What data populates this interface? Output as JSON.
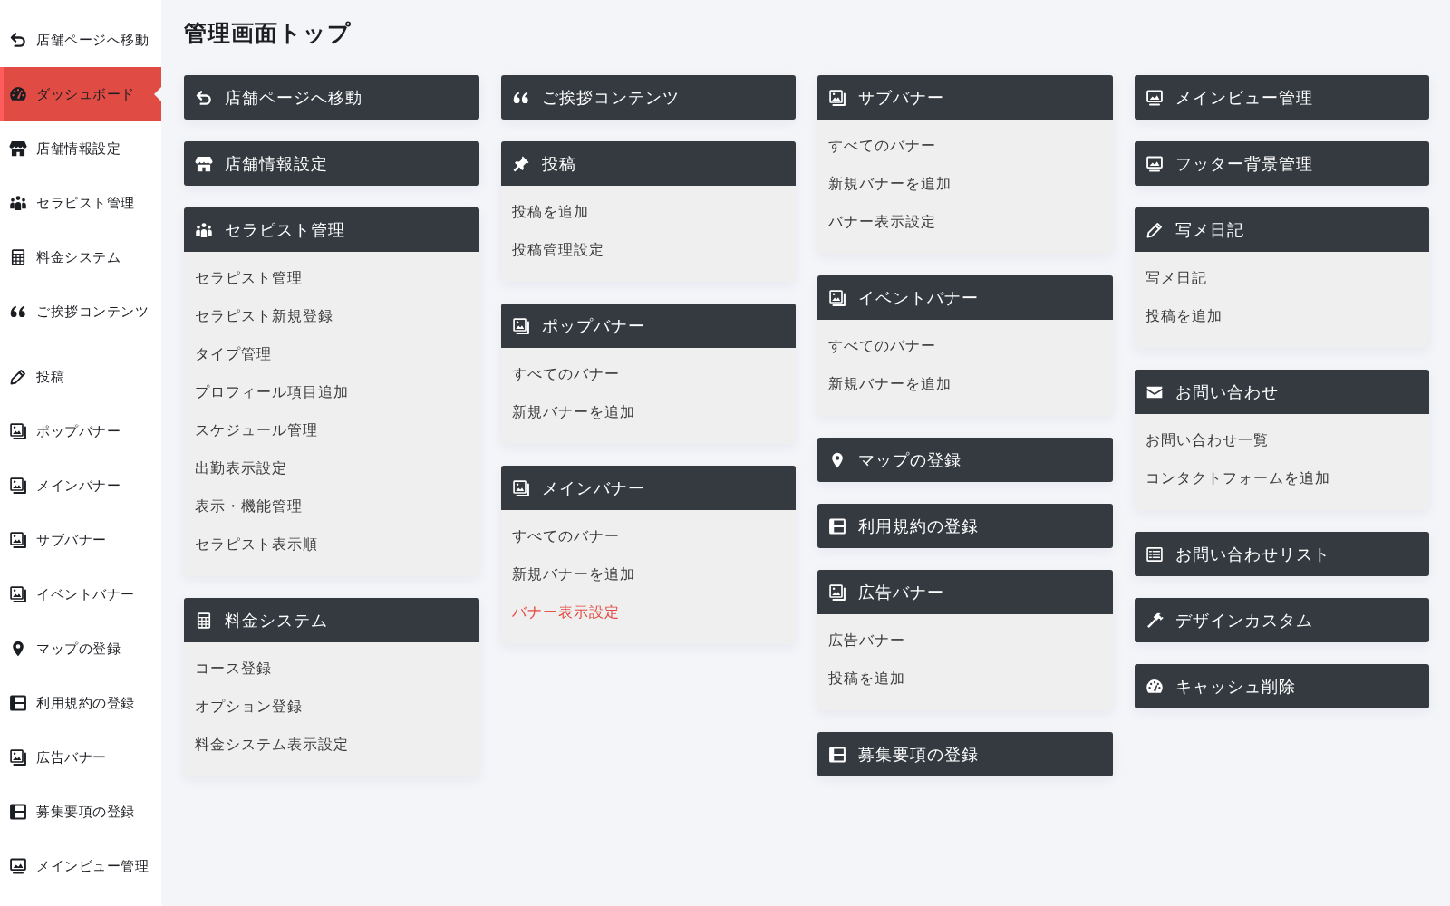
{
  "sidebar": {
    "items": [
      {
        "label": "店舗ページへ移動",
        "selected": false
      },
      {
        "label": "ダッシュボード",
        "selected": true
      },
      {
        "label": "店舗情報設定",
        "selected": false
      },
      {
        "label": "セラピスト管理",
        "selected": false
      },
      {
        "label": "料金システム",
        "selected": false
      },
      {
        "label": "ご挨拶コンテンツ",
        "selected": false
      },
      {
        "label": "投稿",
        "selected": false
      },
      {
        "label": "ポップバナー",
        "selected": false
      },
      {
        "label": "メインバナー",
        "selected": false
      },
      {
        "label": "サブバナー",
        "selected": false
      },
      {
        "label": "イベントバナー",
        "selected": false
      },
      {
        "label": "マップの登録",
        "selected": false
      },
      {
        "label": "利用規約の登録",
        "selected": false
      },
      {
        "label": "広告バナー",
        "selected": false
      },
      {
        "label": "募集要項の登録",
        "selected": false
      },
      {
        "label": "メインビュー管理",
        "selected": false
      }
    ]
  },
  "page_title": "管理画面トップ",
  "columns": [
    {
      "cards": [
        {
          "title": "店舗ページへ移動"
        },
        {
          "title": "店舗情報設定"
        },
        {
          "title": "セラピスト管理",
          "links": [
            {
              "label": "セラピスト管理",
              "hovered": false
            },
            {
              "label": "セラピスト新規登録",
              "hovered": false
            },
            {
              "label": "タイプ管理",
              "hovered": false
            },
            {
              "label": "プロフィール項目追加",
              "hovered": false
            },
            {
              "label": "スケジュール管理",
              "hovered": false
            },
            {
              "label": "出勤表示設定",
              "hovered": false
            },
            {
              "label": "表示・機能管理",
              "hovered": false
            },
            {
              "label": "セラピスト表示順",
              "hovered": false
            }
          ]
        },
        {
          "title": "料金システム",
          "links": [
            {
              "label": "コース登録",
              "hovered": false
            },
            {
              "label": "オプション登録",
              "hovered": false
            },
            {
              "label": "料金システム表示設定",
              "hovered": false
            }
          ]
        }
      ]
    },
    {
      "cards": [
        {
          "title": "ご挨拶コンテンツ"
        },
        {
          "title": "投稿",
          "links": [
            {
              "label": "投稿を追加",
              "hovered": false
            },
            {
              "label": "投稿管理設定",
              "hovered": false
            }
          ]
        },
        {
          "title": "ポップバナー",
          "links": [
            {
              "label": "すべてのバナー",
              "hovered": false
            },
            {
              "label": "新規バナーを追加",
              "hovered": false
            }
          ]
        },
        {
          "title": "メインバナー",
          "links": [
            {
              "label": "すべてのバナー",
              "hovered": false
            },
            {
              "label": "新規バナーを追加",
              "hovered": false
            },
            {
              "label": "バナー表示設定",
              "hovered": true
            }
          ]
        }
      ]
    },
    {
      "cards": [
        {
          "title": "サブバナー",
          "links": [
            {
              "label": "すべてのバナー",
              "hovered": false
            },
            {
              "label": "新規バナーを追加",
              "hovered": false
            },
            {
              "label": "バナー表示設定",
              "hovered": false
            }
          ]
        },
        {
          "title": "イベントバナー",
          "links": [
            {
              "label": "すべてのバナー",
              "hovered": false
            },
            {
              "label": "新規バナーを追加",
              "hovered": false
            }
          ]
        },
        {
          "title": "マップの登録"
        },
        {
          "title": "利用規約の登録"
        },
        {
          "title": "広告バナー",
          "links": [
            {
              "label": "広告バナー",
              "hovered": false
            },
            {
              "label": "投稿を追加",
              "hovered": false
            }
          ]
        },
        {
          "title": "募集要項の登録"
        }
      ]
    },
    {
      "cards": [
        {
          "title": "メインビュー管理"
        },
        {
          "title": "フッター背景管理"
        },
        {
          "title": "写メ日記",
          "links": [
            {
              "label": "写メ日記",
              "hovered": false
            },
            {
              "label": "投稿を追加",
              "hovered": false
            }
          ]
        },
        {
          "title": "お問い合わせ",
          "links": [
            {
              "label": "お問い合わせ一覧",
              "hovered": false
            },
            {
              "label": "コンタクトフォームを追加",
              "hovered": false
            }
          ]
        },
        {
          "title": "お問い合わせリスト"
        },
        {
          "title": "デザインカスタム"
        },
        {
          "title": "キャッシュ削除"
        }
      ]
    }
  ]
}
